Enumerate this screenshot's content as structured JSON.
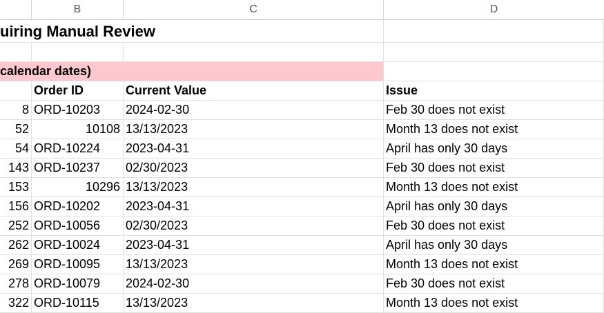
{
  "columns": [
    "B",
    "C",
    "D"
  ],
  "title": "uiring Manual Review",
  "section_label": "calendar dates)",
  "headers": {
    "order_id": "Order ID",
    "current_value": "Current Value",
    "issue": "Issue"
  },
  "rows": [
    {
      "a": "8",
      "b": "ORD-10203",
      "b_numeric": false,
      "c": "2024-02-30",
      "d": "Feb 30 does not exist"
    },
    {
      "a": "52",
      "b": "10108",
      "b_numeric": true,
      "c": "13/13/2023",
      "d": "Month 13 does not exist"
    },
    {
      "a": "54",
      "b": "ORD-10224",
      "b_numeric": false,
      "c": "2023-04-31",
      "d": "April has only 30 days"
    },
    {
      "a": "143",
      "b": "ORD-10237",
      "b_numeric": false,
      "c": "02/30/2023",
      "d": "Feb 30 does not exist"
    },
    {
      "a": "153",
      "b": "10296",
      "b_numeric": true,
      "c": "13/13/2023",
      "d": "Month 13 does not exist"
    },
    {
      "a": "156",
      "b": "ORD-10202",
      "b_numeric": false,
      "c": "2023-04-31",
      "d": "April has only 30 days"
    },
    {
      "a": "252",
      "b": "ORD-10056",
      "b_numeric": false,
      "c": "02/30/2023",
      "d": "Feb 30 does not exist"
    },
    {
      "a": "262",
      "b": "ORD-10024",
      "b_numeric": false,
      "c": "2023-04-31",
      "d": "April has only 30 days"
    },
    {
      "a": "269",
      "b": "ORD-10095",
      "b_numeric": false,
      "c": "13/13/2023",
      "d": "Month 13 does not exist"
    },
    {
      "a": "278",
      "b": "ORD-10079",
      "b_numeric": false,
      "c": "2024-02-30",
      "d": "Feb 30 does not exist"
    },
    {
      "a": "322",
      "b": "ORD-10115",
      "b_numeric": false,
      "c": "13/13/2023",
      "d": "Month 13 does not exist"
    }
  ],
  "colors": {
    "section_fill": "#ffc7ce",
    "grid_line": "#e1e1e1"
  }
}
